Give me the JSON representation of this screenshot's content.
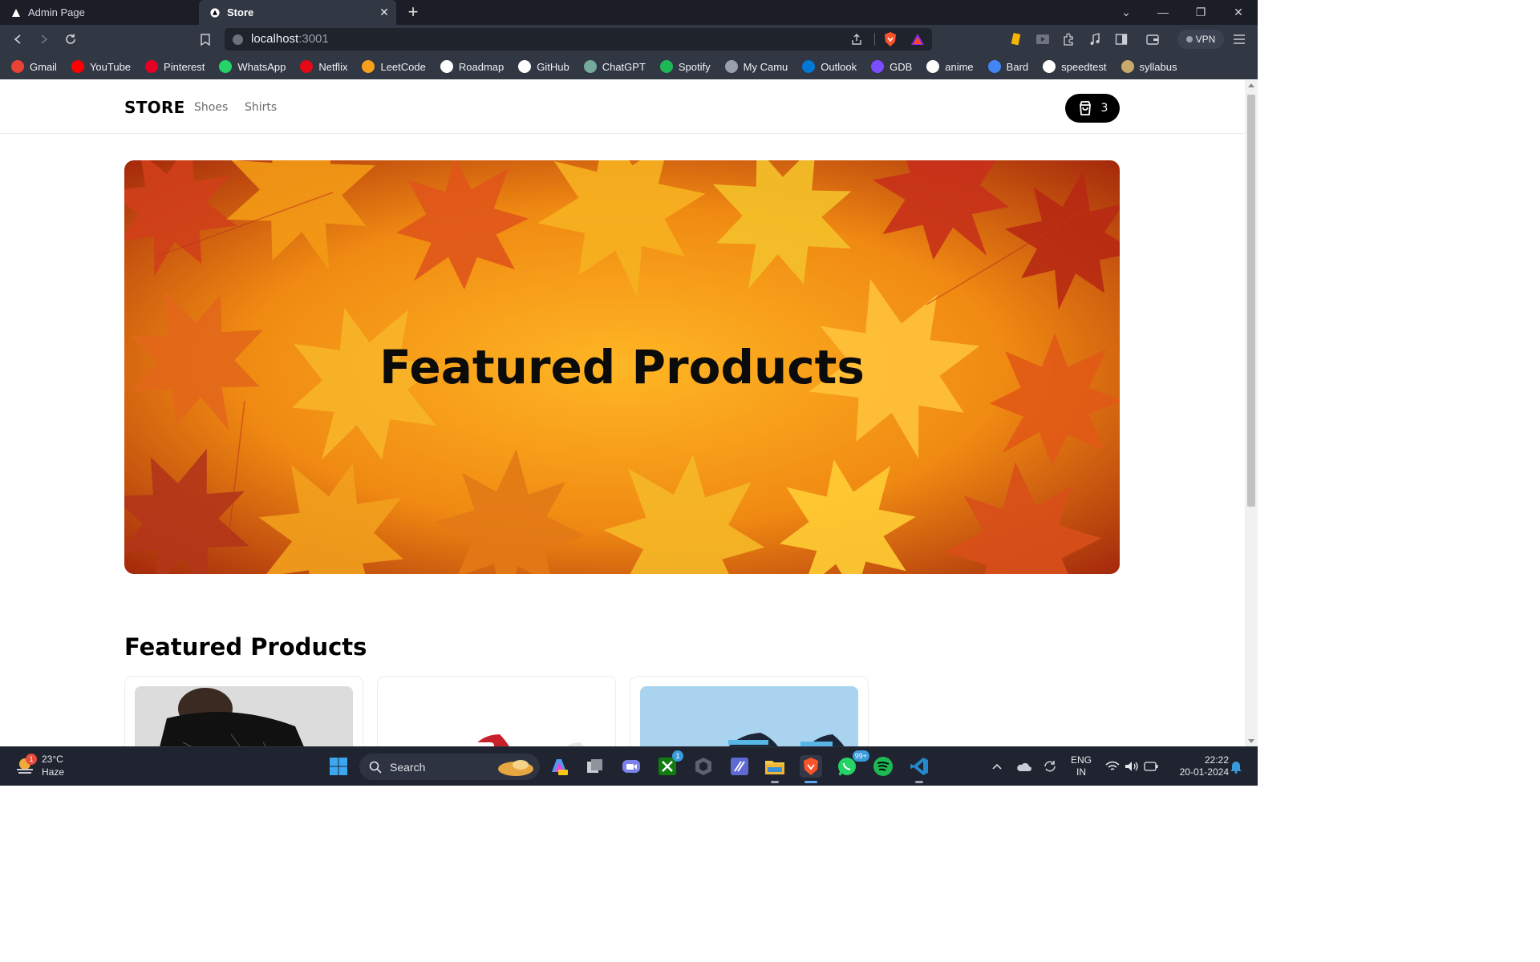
{
  "browser": {
    "tabs": [
      {
        "title": "Admin Page",
        "active": false
      },
      {
        "title": "Store",
        "active": true
      }
    ],
    "url_host": "localhost",
    "url_port": ":3001",
    "vpn_label": "VPN",
    "bookmarks": [
      {
        "label": "Gmail",
        "icon": "gmail-icon",
        "color": "#ea4335"
      },
      {
        "label": "YouTube",
        "icon": "youtube-icon",
        "color": "#ff0000"
      },
      {
        "label": "Pinterest",
        "icon": "pinterest-icon",
        "color": "#e60023"
      },
      {
        "label": "WhatsApp",
        "icon": "whatsapp-icon",
        "color": "#25d366"
      },
      {
        "label": "Netflix",
        "icon": "netflix-icon",
        "color": "#e50914"
      },
      {
        "label": "LeetCode",
        "icon": "leetcode-icon",
        "color": "#f89f1b"
      },
      {
        "label": "Roadmap",
        "icon": "roadmap-icon",
        "color": "#ffffff"
      },
      {
        "label": "GitHub",
        "icon": "github-icon",
        "color": "#ffffff"
      },
      {
        "label": "ChatGPT",
        "icon": "chatgpt-icon",
        "color": "#74aa9c"
      },
      {
        "label": "Spotify",
        "icon": "spotify-icon",
        "color": "#1db954"
      },
      {
        "label": "My Camu",
        "icon": "globe-icon",
        "color": "#9aa0ab"
      },
      {
        "label": "Outlook",
        "icon": "outlook-icon",
        "color": "#0078d4"
      },
      {
        "label": "GDB",
        "icon": "gdb-icon",
        "color": "#7b4dff"
      },
      {
        "label": "anime",
        "icon": "anime-icon",
        "color": "#ffffff"
      },
      {
        "label": "Bard",
        "icon": "bard-icon",
        "color": "#4285f4"
      },
      {
        "label": "speedtest",
        "icon": "speedtest-icon",
        "color": "#ffffff"
      },
      {
        "label": "syllabus",
        "icon": "syllabus-icon",
        "color": "#c9a86b"
      }
    ]
  },
  "store": {
    "brand": "STORE",
    "nav": [
      "Shoes",
      "Shirts"
    ],
    "cart_count": "3",
    "hero_title": "Featured Products",
    "section_title": "Featured Products",
    "products": [
      {
        "image": "black-shirt-model"
      },
      {
        "image": "red-white-sneakers"
      },
      {
        "image": "blue-sneakers"
      }
    ]
  },
  "taskbar": {
    "weather_temp": "23°C",
    "weather_desc": "Haze",
    "weather_badge": "1",
    "search_label": "Search",
    "xbox_badge": "1",
    "whatsapp_badge": "99+",
    "lang_top": "ENG",
    "lang_bottom": "IN",
    "time": "22:22",
    "date": "20-01-2024"
  },
  "colors": {
    "tabbar_bg": "#1b1e27",
    "toolbar_bg": "#323744",
    "cart_bg": "#000000",
    "taskbar_bg": "#1f2430"
  }
}
